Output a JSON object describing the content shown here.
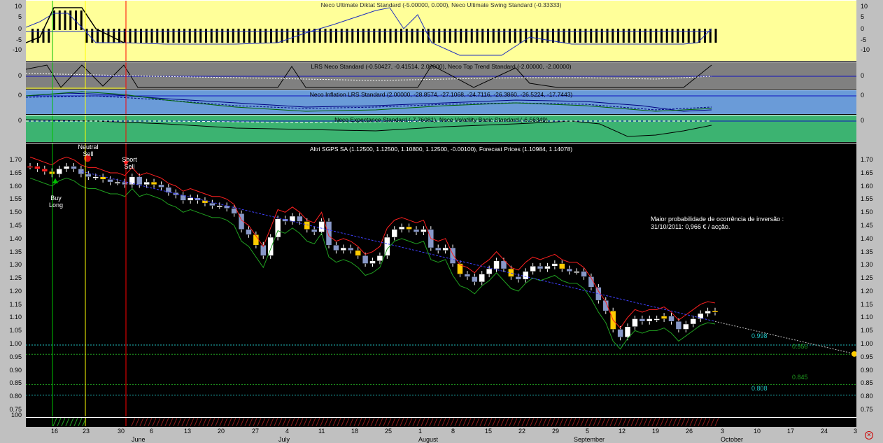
{
  "panels": {
    "diktat": {
      "title": "Neco Ultimate Diktat Standard (-5.00000, 0.000), Neco Ultimate Swing Standard (-0.33333)",
      "bg": "#ffff99",
      "ticks": [
        "10",
        "5",
        "0",
        "-5",
        "-10"
      ]
    },
    "lrs": {
      "title": "LRS Neco Standard (-0.50427, -0.41514, 2.00000), Neco Top Trend Standard (-2.00000, -2.00000)",
      "bg": "#808080",
      "ticks": [
        "0"
      ]
    },
    "inflation": {
      "title": "Neco Inflation LRS Standard (2.00000, -28.8574, -27.1068, -24.7116, -26.3860, -26.5224, -17.7443)",
      "bg": "#6a9bd8",
      "ticks": [
        "0"
      ]
    },
    "expectance": {
      "title": "Neco Expectance Standard (-7.76081), Neco Volatility Basic Standard (-6.56349)",
      "bg": "#3cb371",
      "ticks": [
        "0"
      ]
    },
    "price": {
      "title": "Altri SGPS SA (1.12500, 1.12500, 1.10800, 1.12500, -0.00100), Forecast Prices (1.10984, 1.14078)",
      "bg": "#000000",
      "ticks": [
        "1.70",
        "1.65",
        "1.60",
        "1.55",
        "1.50",
        "1.45",
        "1.40",
        "1.35",
        "1.30",
        "1.25",
        "1.20",
        "1.15",
        "1.10",
        "1.05",
        "1.00",
        "0.95",
        "0.90",
        "0.85",
        "0.80",
        "0.75"
      ]
    }
  },
  "signals": {
    "buy": "Buy\nLong",
    "neutral": "Neutral\nSell",
    "short": "Short\nSell"
  },
  "note": {
    "line1": "Maior probabilidade de ocorrência de inversão :",
    "line2": "31/10/2011: 0,966 € / acção."
  },
  "levels": {
    "a": "0.998",
    "b": "0.956",
    "c": "0.845",
    "d": "0.808"
  },
  "volume_ticks": [
    "100"
  ],
  "x_axis": {
    "days": [
      "16",
      "23",
      "30",
      "6",
      "13",
      "20",
      "27",
      "4",
      "11",
      "18",
      "25",
      "1",
      "8",
      "15",
      "22",
      "29",
      "5",
      "12",
      "19",
      "26",
      "3",
      "10",
      "17",
      "24",
      "3"
    ],
    "months": [
      "June",
      "July",
      "August",
      "September",
      "October"
    ]
  },
  "colors": {
    "buy_line": "#00c000",
    "neutral_line": "#ffff00",
    "short_line": "#ff0000",
    "trend": "#4040ff",
    "upper": "#ff2020",
    "lower": "#20a020"
  },
  "chart_data": {
    "type": "candlestick",
    "title": "Altri SGPS SA (1.12500, 1.12500, 1.10800, 1.12500, -0.00100), Forecast Prices (1.10984, 1.14078)",
    "ylim": [
      0.75,
      1.74
    ],
    "close": [
      1.68,
      1.67,
      1.66,
      1.65,
      1.67,
      1.68,
      1.67,
      1.65,
      1.64,
      1.64,
      1.63,
      1.62,
      1.62,
      1.61,
      1.64,
      1.61,
      1.62,
      1.61,
      1.6,
      1.58,
      1.57,
      1.55,
      1.56,
      1.55,
      1.54,
      1.53,
      1.53,
      1.52,
      1.5,
      1.44,
      1.42,
      1.38,
      1.34,
      1.41,
      1.48,
      1.47,
      1.49,
      1.47,
      1.44,
      1.43,
      1.47,
      1.38,
      1.36,
      1.37,
      1.36,
      1.34,
      1.31,
      1.32,
      1.34,
      1.41,
      1.44,
      1.45,
      1.44,
      1.43,
      1.44,
      1.37,
      1.36,
      1.37,
      1.31,
      1.27,
      1.26,
      1.24,
      1.27,
      1.29,
      1.32,
      1.29,
      1.26,
      1.25,
      1.28,
      1.3,
      1.29,
      1.3,
      1.31,
      1.29,
      1.28,
      1.28,
      1.26,
      1.22,
      1.17,
      1.13,
      1.06,
      1.03,
      1.07,
      1.1,
      1.09,
      1.1,
      1.1,
      1.11,
      1.09,
      1.06,
      1.08,
      1.1,
      1.12,
      1.13,
      1.125
    ],
    "forecast_end": 0.966
  }
}
